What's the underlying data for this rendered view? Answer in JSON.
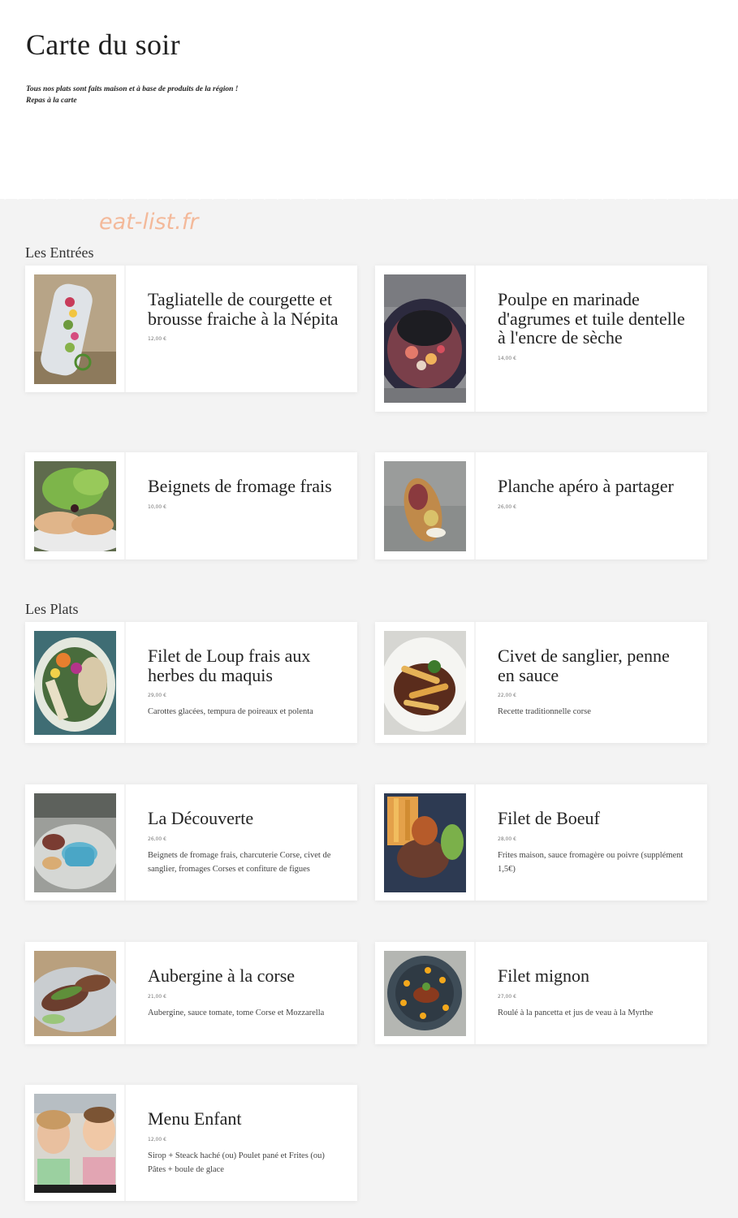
{
  "page": {
    "title": "Carte du soir",
    "intro_line1": "Tous nos plats sont faits maison et à base de produits de la région !",
    "intro_line2": "Repas à la carte",
    "watermark": "eat-list.fr"
  },
  "colors": {
    "background": "#f3f3f3",
    "card": "#ffffff",
    "watermark": "#f3b99a"
  },
  "sections": [
    {
      "title": "Les Entrées",
      "dishes": [
        {
          "name": "Tagliatelle de courgette et brousse fraiche à la Népita",
          "price": "12,00 €",
          "description": "",
          "image": "courgette-tagliatelle-photo"
        },
        {
          "name": "Poulpe en marinade d'agrumes et tuile dentelle à l'encre de sèche",
          "price": "14,00 €",
          "description": "",
          "image": "octopus-bowl-photo"
        },
        {
          "name": "Beignets de fromage frais",
          "price": "10,00 €",
          "description": "",
          "image": "cheese-fritters-photo"
        },
        {
          "name": "Planche apéro à partager",
          "price": "26,00 €",
          "description": "",
          "image": "aperitif-board-photo"
        }
      ]
    },
    {
      "title": "Les Plats",
      "dishes": [
        {
          "name": "Filet de Loup frais aux herbes du maquis",
          "price": "29,00 €",
          "description": "Carottes glacées, tempura de poireaux et polenta",
          "image": "sea-bass-photo"
        },
        {
          "name": "Civet de sanglier, penne en sauce",
          "price": "22,00 €",
          "description": "Recette traditionnelle corse",
          "image": "boar-stew-photo"
        },
        {
          "name": "La Découverte",
          "price": "26,00 €",
          "description": "Beignets de fromage frais, charcuterie Corse, civet de sanglier, fromages Corses et confiture de figues",
          "image": "discovery-plate-photo"
        },
        {
          "name": "Filet de Boeuf",
          "price": "28,00 €",
          "description": "Frites maison, sauce fromagère ou poivre (supplément 1,5€)",
          "image": "beef-fillet-photo"
        },
        {
          "name": "Aubergine à la corse",
          "price": "21,00 €",
          "description": "Aubergine, sauce tomate, tome Corse et Mozzarella",
          "image": "eggplant-photo"
        },
        {
          "name": "Filet mignon",
          "price": "27,00 €",
          "description": "Roulé à la pancetta et jus de veau à la Myrthe",
          "image": "pork-tenderloin-photo"
        },
        {
          "name": "Menu Enfant",
          "price": "12,00 €",
          "description": "Sirop + Steack haché (ou) Poulet pané et Frites (ou) Pâtes + boule de glace",
          "image": "children-photo"
        }
      ]
    }
  ]
}
